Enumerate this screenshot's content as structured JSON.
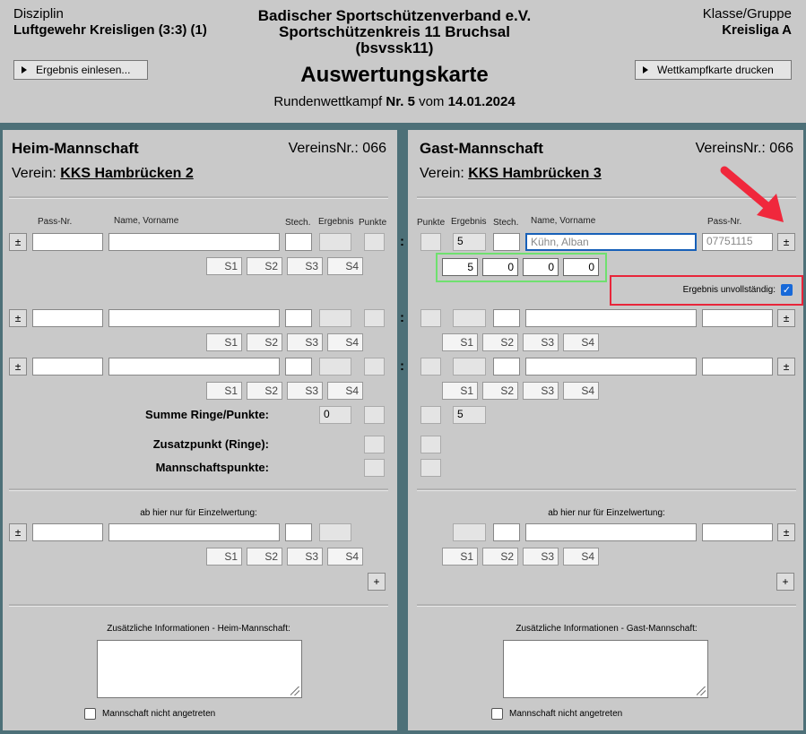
{
  "header": {
    "disziplin_label": "Disziplin",
    "disziplin_value": "Luftgewehr Kreisligen (3:3) (1)",
    "org_line1": "Badischer Sportschützenverband e.V.",
    "org_line2": "Sportschützenkreis 11 Bruchsal",
    "org_line3": "(bsvssk11)",
    "title": "Auswertungskarte",
    "round_prefix": "Rundenwettkampf",
    "round_nr": "Nr. 5",
    "round_mid": "vom",
    "round_date": "14.01.2024",
    "klasse_label": "Klasse/Gruppe",
    "klasse_value": "Kreisliga A",
    "btn_import": "Ergebnis einlesen...",
    "btn_print": "Wettkampfkarte drucken"
  },
  "home": {
    "title": "Heim-Mannschaft",
    "vereinsnr": "VereinsNr.: 066",
    "verein_label": "Verein:",
    "verein_name": "KKS Hambrücken 2",
    "col_pass": "Pass-Nr.",
    "col_name": "Name, Vorname",
    "col_stech": "Stech.",
    "col_ergebnis": "Ergebnis",
    "col_punkte": "Punkte",
    "summe_label": "Summe Ringe/Punkte:",
    "summe_value": "0",
    "zusatz_label": "Zusatzpunkt (Ringe):",
    "mannschaft_label": "Mannschaftspunkte:",
    "einzel_label": "ab hier nur für Einzelwertung:",
    "info_label": "Zusätzliche Informationen - Heim-Mannschaft:",
    "not_present": "Mannschaft nicht angetreten"
  },
  "guest": {
    "title": "Gast-Mannschaft",
    "vereinsnr": "VereinsNr.: 066",
    "verein_label": "Verein:",
    "verein_name": "KKS Hambrücken 3",
    "col_punkte": "Punkte",
    "col_ergebnis": "Ergebnis",
    "col_stech": "Stech.",
    "col_name": "Name, Vorname",
    "col_pass": "Pass-Nr.",
    "row1_ergebnis": "5",
    "row1_name": "Kühn, Alban",
    "row1_pass": "07751115",
    "row1_s1": "5",
    "row1_s2": "0",
    "row1_s3": "0",
    "row1_s4": "0",
    "incomplete_label": "Ergebnis unvollständig:",
    "summe_value": "5",
    "einzel_label": "ab hier nur für Einzelwertung:",
    "info_label": "Zusätzliche Informationen - Gast-Mannschaft:",
    "not_present": "Mannschaft nicht angetreten"
  },
  "common": {
    "pm": "±",
    "plus": "+",
    "colon": ":",
    "s1": "S1",
    "s2": "S2",
    "s3": "S3",
    "s4": "S4"
  },
  "colors": {
    "frame": "#4d7078",
    "highlight_green": "#6fe06f",
    "highlight_red": "#e8253a",
    "arrow_red": "#f0283c",
    "focus_blue": "#1760b8"
  }
}
